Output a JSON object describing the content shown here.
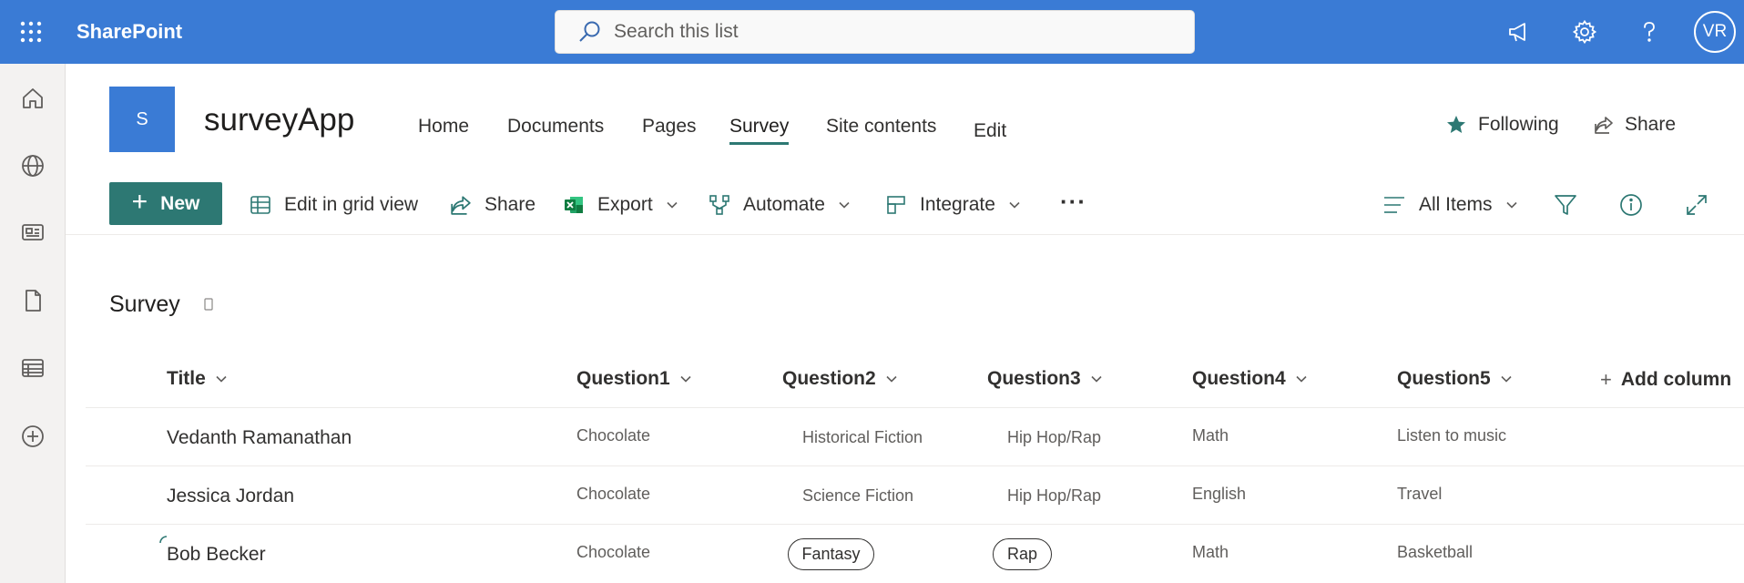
{
  "suite": {
    "app_name": "SharePoint",
    "search_placeholder": "Search this list",
    "avatar_initials": "VR",
    "icons": [
      "waffle-icon",
      "search-icon",
      "megaphone-icon",
      "gear-icon",
      "help-icon"
    ],
    "colors": {
      "bar": "#3a7bd5",
      "accent": "#2d7873"
    }
  },
  "rail": {
    "items": [
      "home-icon",
      "globe-icon",
      "news-icon",
      "file-icon",
      "list-icon",
      "add-icon"
    ]
  },
  "site": {
    "logo_letter": "S",
    "title": "surveyApp",
    "nav": [
      {
        "label": "Home"
      },
      {
        "label": "Documents"
      },
      {
        "label": "Pages"
      },
      {
        "label": "Survey",
        "active": true
      },
      {
        "label": "Site contents"
      },
      {
        "label": "Edit"
      }
    ],
    "following_label": "Following",
    "share_label": "Share"
  },
  "commands": {
    "new_label": "New",
    "grid_label": "Edit in grid view",
    "share_label": "Share",
    "export_label": "Export",
    "automate_label": "Automate",
    "integrate_label": "Integrate",
    "more_label": "···",
    "view_label": "All Items"
  },
  "list": {
    "title": "Survey",
    "columns": [
      "Title",
      "Question1",
      "Question2",
      "Question3",
      "Question4",
      "Question5"
    ],
    "add_column_label": "Add column",
    "rows": [
      {
        "title": "Vedanth Ramanathan",
        "q1": "Chocolate",
        "q2": "Historical Fiction",
        "q3": "Hip Hop/Rap",
        "q4": "Math",
        "q5": "Listen to music"
      },
      {
        "title": "Jessica Jordan",
        "q1": "Chocolate",
        "q2": "Science Fiction",
        "q3": "Hip Hop/Rap",
        "q4": "English",
        "q5": "Travel"
      },
      {
        "title": "Bob Becker",
        "q1": "Chocolate",
        "q2": "Fantasy",
        "q3": "Rap",
        "q4": "Math",
        "q5": "Basketball"
      }
    ]
  }
}
